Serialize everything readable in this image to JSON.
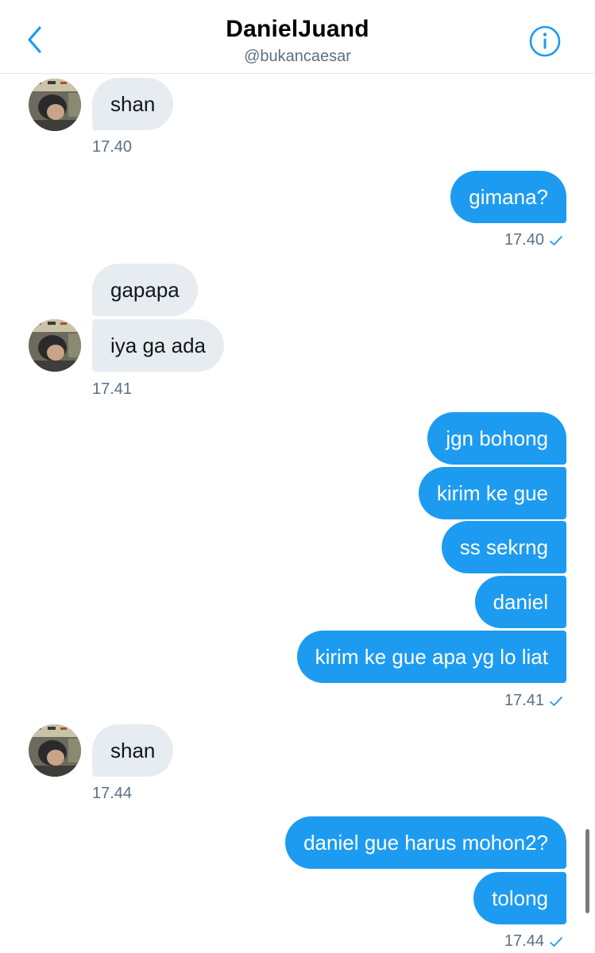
{
  "header": {
    "title": "DanielJuand",
    "handle": "@bukancaesar",
    "back_icon": "chevron-left-icon",
    "info_icon": "info-icon",
    "accent_color": "#1d9bf0"
  },
  "messages": [
    {
      "from": "them",
      "text": "shan"
    },
    {
      "from": "them",
      "time": "17.40"
    },
    {
      "from": "me",
      "text": "gimana?"
    },
    {
      "from": "me",
      "time": "17.40"
    },
    {
      "from": "them",
      "text": "gapapa"
    },
    {
      "from": "them",
      "text": "iya ga ada"
    },
    {
      "from": "them",
      "time": "17.41"
    },
    {
      "from": "me",
      "text": "jgn bohong"
    },
    {
      "from": "me",
      "text": "kirim ke gue"
    },
    {
      "from": "me",
      "text": "ss sekrng"
    },
    {
      "from": "me",
      "text": "daniel"
    },
    {
      "from": "me",
      "text": "kirim ke gue apa yg lo liat"
    },
    {
      "from": "me",
      "time": "17.41"
    },
    {
      "from": "them",
      "text": "shan"
    },
    {
      "from": "them",
      "time": "17.44"
    },
    {
      "from": "me",
      "text": "daniel gue harus mohon2?"
    },
    {
      "from": "me",
      "text": "tolong"
    },
    {
      "from": "me",
      "time": "17.44"
    }
  ]
}
